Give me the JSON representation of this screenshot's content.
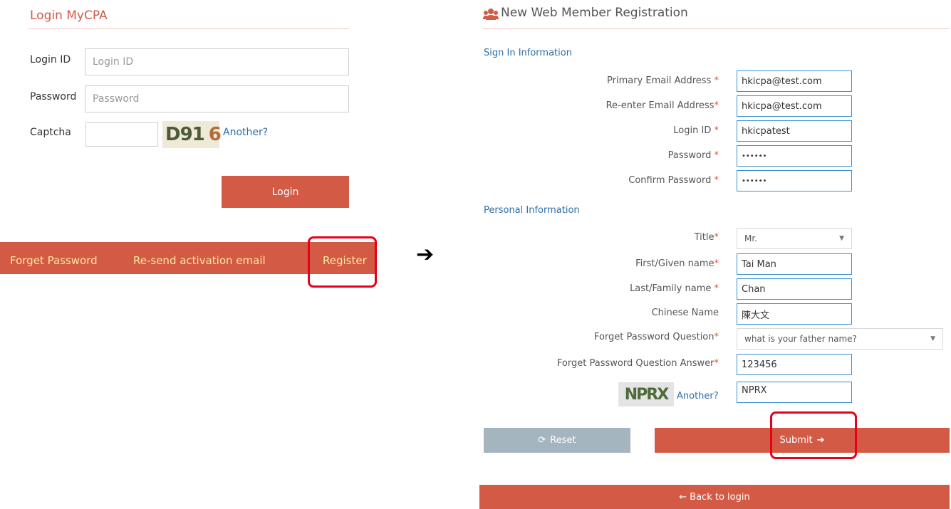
{
  "login": {
    "title": "Login MyCPA",
    "login_id_label": "Login ID",
    "login_id_placeholder": "Login ID",
    "password_label": "Password",
    "password_placeholder": "Password",
    "captcha_label": "Captcha",
    "captcha_text_a": "D91",
    "captcha_text_b": "6",
    "another_label": "Another?",
    "login_button": "Login"
  },
  "footer": {
    "forget_password": "Forget Password",
    "resend": "Re-send activation email",
    "register": "Register"
  },
  "arrow_glyph": "➔",
  "registration": {
    "title": "New Web Member Registration",
    "sign_in_section": "Sign In Information",
    "personal_section": "Personal Information",
    "required_mark": "*",
    "fields": {
      "primary_email": {
        "label": "Primary Email Address",
        "value": "hkicpa@test.com"
      },
      "reenter_email": {
        "label": "Re-enter Email Address",
        "value": "hkicpa@test.com"
      },
      "login_id": {
        "label": "Login ID",
        "value": "hkicpatest"
      },
      "password": {
        "label": "Password",
        "value": "••••••"
      },
      "confirm_password": {
        "label": "Confirm Password",
        "value": "••••••"
      },
      "title": {
        "label": "Title",
        "value": "Mr."
      },
      "first_name": {
        "label": "First/Given name",
        "value": "Tai Man"
      },
      "last_name": {
        "label": "Last/Family name",
        "value": "Chan"
      },
      "chinese_name": {
        "label": "Chinese Name",
        "value": "陳大文"
      },
      "question": {
        "label": "Forget Password Question",
        "value": "what is your father name?"
      },
      "answer": {
        "label": "Forget Password Question Answer",
        "value": "123456"
      },
      "captcha": {
        "image_text": "NPRX",
        "another": "Another?",
        "value": "NPRX"
      }
    },
    "reset_button": "Reset",
    "submit_button": "Submit",
    "back_button": "Back to login"
  },
  "colors": {
    "accent": "#d35a44",
    "link": "#2f6ea8",
    "highlight": "#e8001a",
    "reset": "#a5b5bf"
  }
}
